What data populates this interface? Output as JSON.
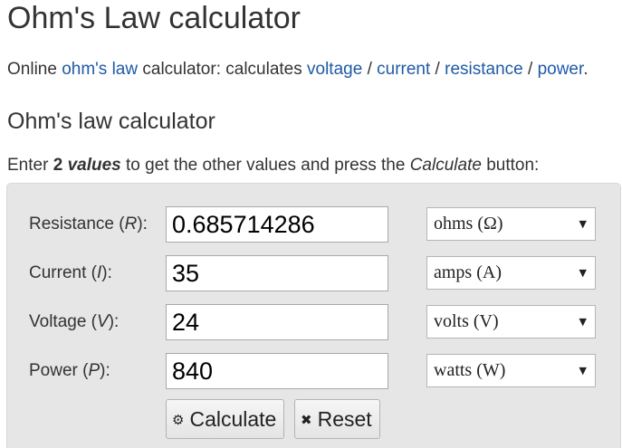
{
  "page": {
    "title": "Ohm's Law calculator",
    "intro": {
      "prefix": "Online ",
      "link_ohms_law": "ohm's law",
      "middle": " calculator: calculates ",
      "link_voltage": "voltage",
      "sep1": " / ",
      "link_current": "current",
      "sep2": " / ",
      "link_resistance": "resistance",
      "sep3": " / ",
      "link_power": "power",
      "suffix": "."
    },
    "section_title": "Ohm's law calculator",
    "instruction": {
      "prefix": "Enter ",
      "bold_number": "2 ",
      "bold_italic": "values",
      "middle": " to get the other values and press the ",
      "italic_button": "Calculate",
      "suffix": " button:"
    }
  },
  "calculator": {
    "rows": [
      {
        "label_prefix": "Resistance (",
        "symbol": "R",
        "label_suffix": "):",
        "value": "0.685714286",
        "unit": "ohms (Ω)"
      },
      {
        "label_prefix": "Current (",
        "symbol": "I",
        "label_suffix": "):",
        "value": "35",
        "unit": "amps (A)"
      },
      {
        "label_prefix": "Voltage (",
        "symbol": "V",
        "label_suffix": "):",
        "value": "24",
        "unit": "volts (V)"
      },
      {
        "label_prefix": "Power (",
        "symbol": "P",
        "label_suffix": "):",
        "value": "840",
        "unit": "watts (W)"
      }
    ],
    "dropdown_arrow": "▼",
    "calculate_label": "Calculate",
    "calculate_icon": "⚙",
    "reset_label": "Reset",
    "reset_icon": "✖"
  },
  "colors": {
    "link": "#1f5aa6",
    "panel_bg": "#e6e6e6",
    "text": "#333333"
  },
  "icons": {
    "calculate": "gear-icon",
    "reset": "close-icon",
    "dropdown": "chevron-down-icon"
  }
}
